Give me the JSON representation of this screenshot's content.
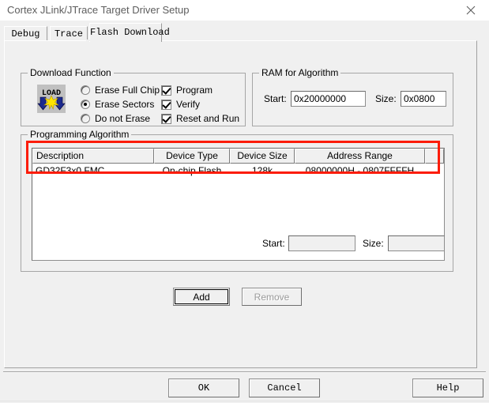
{
  "window": {
    "title": "Cortex JLink/JTrace Target Driver Setup",
    "close_icon": "close-icon"
  },
  "tabs": [
    {
      "label": "Debug",
      "active": false
    },
    {
      "label": "Trace",
      "active": false
    },
    {
      "label": "Flash Download",
      "active": true
    }
  ],
  "download_function": {
    "group_label": "Download Function",
    "icon": "load-flash-icon",
    "icon_text": "LOAD",
    "erase_mode": "Erase Sectors",
    "radios": [
      {
        "label": "Erase Full Chip",
        "checked": false
      },
      {
        "label": "Erase Sectors",
        "checked": true
      },
      {
        "label": "Do not Erase",
        "checked": false
      }
    ],
    "checkboxes": [
      {
        "label": "Program",
        "checked": true
      },
      {
        "label": "Verify",
        "checked": true
      },
      {
        "label": "Reset and Run",
        "checked": true
      }
    ]
  },
  "ram_for_algorithm": {
    "group_label": "RAM for Algorithm",
    "start_label": "Start:",
    "start_value": "0x20000000",
    "size_label": "Size:",
    "size_value": "0x0800"
  },
  "programming_algorithm": {
    "group_label": "Programming Algorithm",
    "columns": [
      "Description",
      "Device Type",
      "Device Size",
      "Address Range",
      ""
    ],
    "rows": [
      {
        "description": "GD32F3x0 FMC",
        "device_type": "On-chip Flash",
        "device_size": "128k",
        "address_range": "08000000H - 0807FFFFH"
      }
    ],
    "start_label": "Start:",
    "start_value": "",
    "size_label": "Size:",
    "size_value": "",
    "add_label": "Add",
    "remove_label": "Remove",
    "highlight_color": "#fc1c08"
  },
  "footer": {
    "ok_label": "OK",
    "cancel_label": "Cancel",
    "help_label": "Help"
  }
}
